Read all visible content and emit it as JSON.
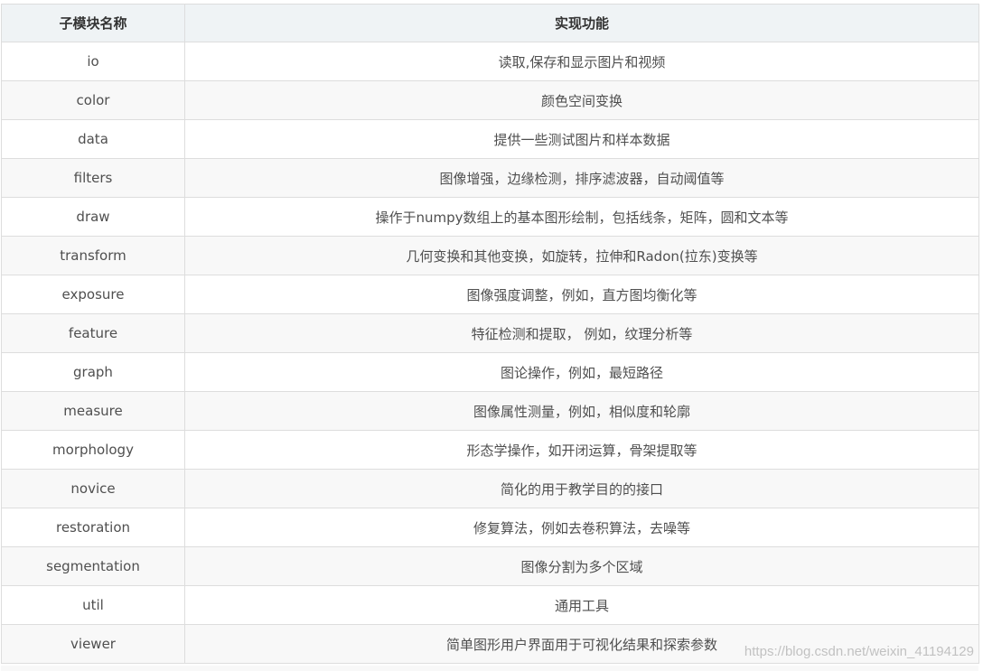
{
  "table": {
    "headers": [
      "子模块名称",
      "实现功能"
    ],
    "rows": [
      [
        "io",
        "读取,保存和显示图片和视频"
      ],
      [
        "color",
        "颜色空间变换"
      ],
      [
        "data",
        "提供一些测试图片和样本数据"
      ],
      [
        "filters",
        "图像增强，边缘检测，排序滤波器，自动阈值等"
      ],
      [
        "draw",
        "操作于numpy数组上的基本图形绘制，包括线条，矩阵，圆和文本等"
      ],
      [
        "transform",
        "几何变换和其他变换，如旋转，拉伸和Radon(拉东)变换等"
      ],
      [
        "exposure",
        "图像强度调整，例如，直方图均衡化等"
      ],
      [
        "feature",
        "特征检测和提取， 例如，纹理分析等"
      ],
      [
        "graph",
        "图论操作，例如，最短路径"
      ],
      [
        "measure",
        "图像属性测量，例如，相似度和轮廓"
      ],
      [
        "morphology",
        "形态学操作，如开闭运算，骨架提取等"
      ],
      [
        "novice",
        "简化的用于教学目的的接口"
      ],
      [
        "restoration",
        "修复算法，例如去卷积算法，去噪等"
      ],
      [
        "segmentation",
        "图像分割为多个区域"
      ],
      [
        "util",
        "通用工具"
      ],
      [
        "viewer",
        "简单图形用户界面用于可视化结果和探索参数"
      ]
    ]
  },
  "watermark": "https://blog.csdn.net/weixin_41194129"
}
